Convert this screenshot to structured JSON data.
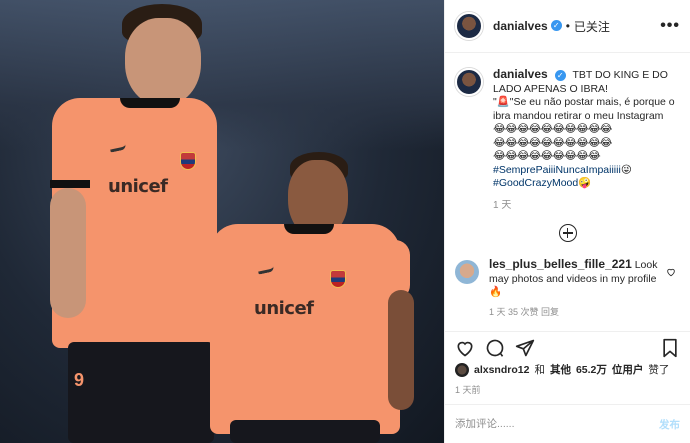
{
  "post": {
    "username": "danialves",
    "verified_mark": "✓",
    "separator": "•",
    "follow_status": "已关注",
    "more_glyph": "•••"
  },
  "caption": {
    "username": "danialves",
    "line1": "TBT DO KING E DO LADO APENAS O IBRA!",
    "line2": "\"🚨\"Se eu não postar mais, é porque o ibra mandou retirar o meu Instagram",
    "emoji_line1": "😂😂😂😂😂😂😂😂😂😂",
    "emoji_line2": "😂😂😂😂😂😂😂😂😂😂",
    "emoji_line3": "😂😂😂😂😂😂😂😂😂",
    "hashtag1": "#SemprePaiiiNuncaImpaiiiii",
    "hashtag1_emoji": "😜",
    "hashtag2": "#GoodCrazyMood",
    "hashtag2_emoji": "🤪",
    "time": "1 天"
  },
  "comment": {
    "username": "les_plus_belles_fille_221",
    "text": "Look may photos and videos in my profile",
    "emoji": "🔥",
    "meta": "1 天  35 次赞  回复"
  },
  "likes": {
    "user": "alxsndro12",
    "and": "和",
    "others": "其他",
    "count": "65.2万",
    "suffix": "位用户",
    "liked": "赞了"
  },
  "post_date": "1 天前",
  "add_comment": {
    "placeholder": "添加评论......",
    "post_label": "发布"
  },
  "photo": {
    "sponsor_left": "unicef",
    "sponsor_right": "unicef",
    "shorts_number": "9"
  },
  "colors": {
    "shirt": "#f5946c",
    "link": "#003569",
    "verified": "#3897f0",
    "post_button": "#b2dffc"
  }
}
